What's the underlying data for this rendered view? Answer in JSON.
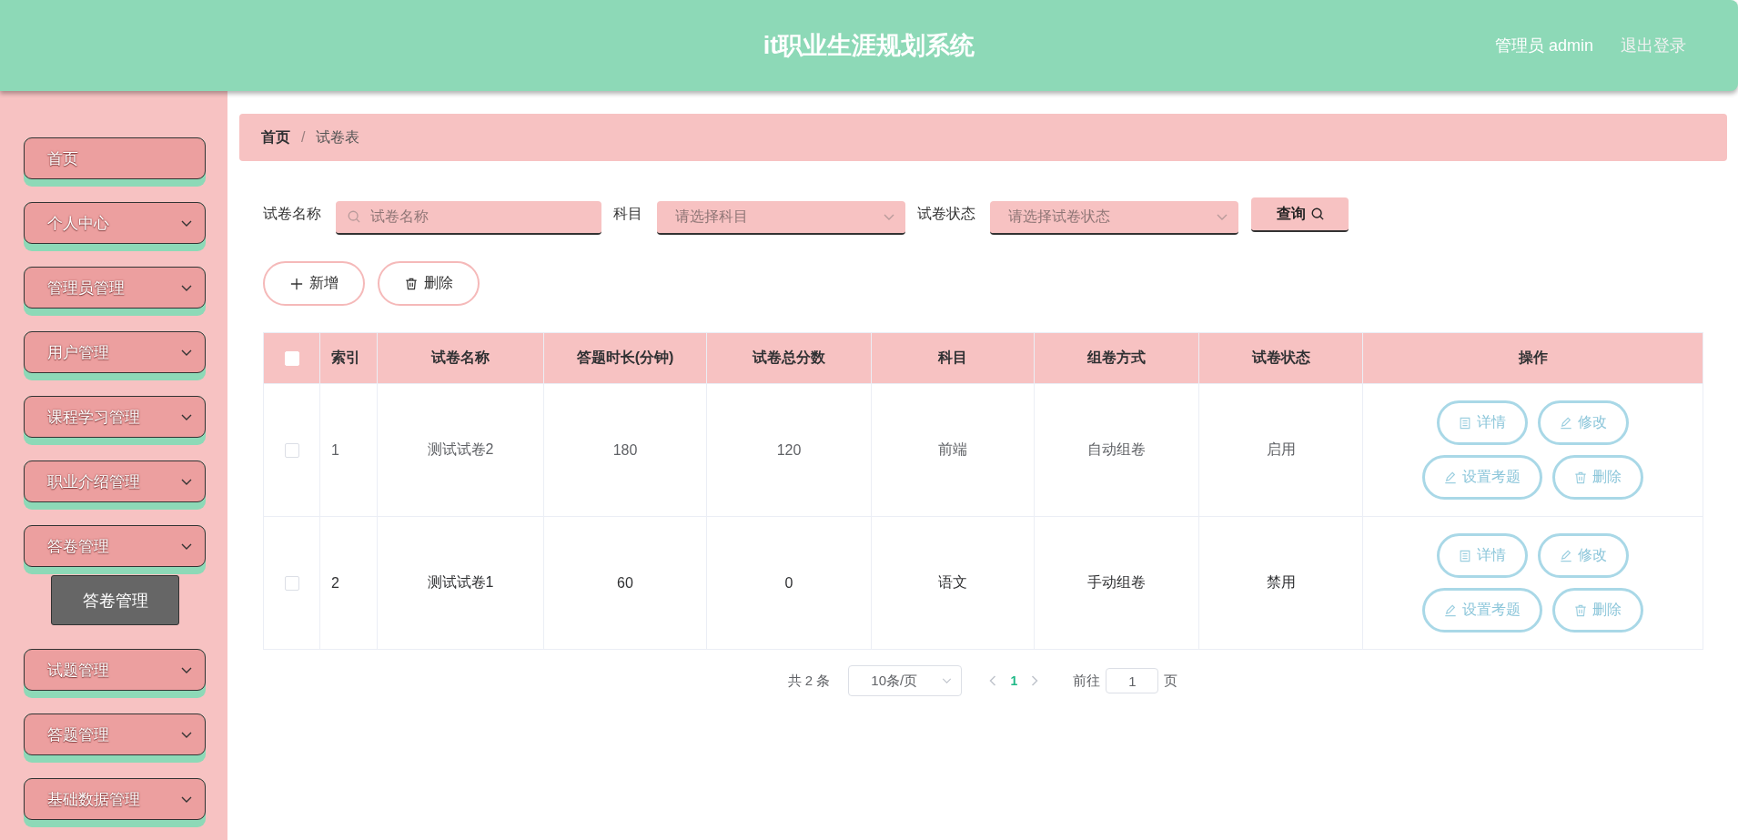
{
  "header": {
    "title": "it职业生涯规划系统",
    "user": "管理员 admin",
    "logout": "退出登录"
  },
  "sidebar": {
    "items": [
      {
        "label": "首页",
        "kind": "link"
      },
      {
        "label": "个人中心",
        "kind": "menu"
      },
      {
        "label": "管理员管理",
        "kind": "menu"
      },
      {
        "label": "用户管理",
        "kind": "menu"
      },
      {
        "label": "课程学习管理",
        "kind": "menu"
      },
      {
        "label": "职业介绍管理",
        "kind": "menu"
      },
      {
        "label": "答卷管理",
        "kind": "menu",
        "children": [
          {
            "label": "答卷管理"
          }
        ]
      },
      {
        "label": "试题管理",
        "kind": "menu"
      },
      {
        "label": "答题管理",
        "kind": "menu"
      },
      {
        "label": "基础数据管理",
        "kind": "menu"
      }
    ]
  },
  "breadcrumb": {
    "items": [
      {
        "label": "首页",
        "kind": "home"
      },
      {
        "label": "试卷表",
        "kind": "current"
      }
    ],
    "separator": "/"
  },
  "filters": {
    "fields": [
      {
        "label": "试卷名称",
        "kind": "input",
        "placeholder": "试卷名称"
      },
      {
        "label": "科目",
        "kind": "select",
        "placeholder": "请选择科目"
      },
      {
        "label": "试卷状态",
        "kind": "select",
        "placeholder": "请选择试卷状态"
      }
    ],
    "search_button": "查询"
  },
  "toolbar": [
    {
      "label": "新增",
      "kind": "add"
    },
    {
      "label": "删除",
      "kind": "delete"
    }
  ],
  "table": {
    "select_all": false,
    "columns": [
      "索引",
      "试卷名称",
      "答题时长(分钟)",
      "试卷总分数",
      "科目",
      "组卷方式",
      "试卷状态",
      "操作"
    ],
    "rows": [
      {
        "checked": false,
        "hover": false,
        "cells": [
          "1",
          "测试试卷2",
          "180",
          "120",
          "前端",
          "自动组卷",
          "启用"
        ],
        "actions": [
          {
            "label": "详情",
            "kind": "detail"
          },
          {
            "label": "修改",
            "kind": "edit"
          },
          {
            "label": "设置考题",
            "kind": "questions"
          },
          {
            "label": "删除",
            "kind": "delete"
          }
        ]
      },
      {
        "checked": false,
        "hover": true,
        "cells": [
          "2",
          "测试试卷1",
          "60",
          "0",
          "语文",
          "手动组卷",
          "禁用"
        ],
        "actions": [
          {
            "label": "详情",
            "kind": "detail"
          },
          {
            "label": "修改",
            "kind": "edit"
          },
          {
            "label": "设置考题",
            "kind": "questions"
          },
          {
            "label": "删除",
            "kind": "delete"
          }
        ]
      }
    ]
  },
  "pagination": {
    "total": "共 2 条",
    "page_size": "10条/页",
    "pages": [
      {
        "label": "1",
        "selected": true
      }
    ],
    "goto_label": "前往",
    "goto_value": "1",
    "goto_suffix": "页"
  }
}
